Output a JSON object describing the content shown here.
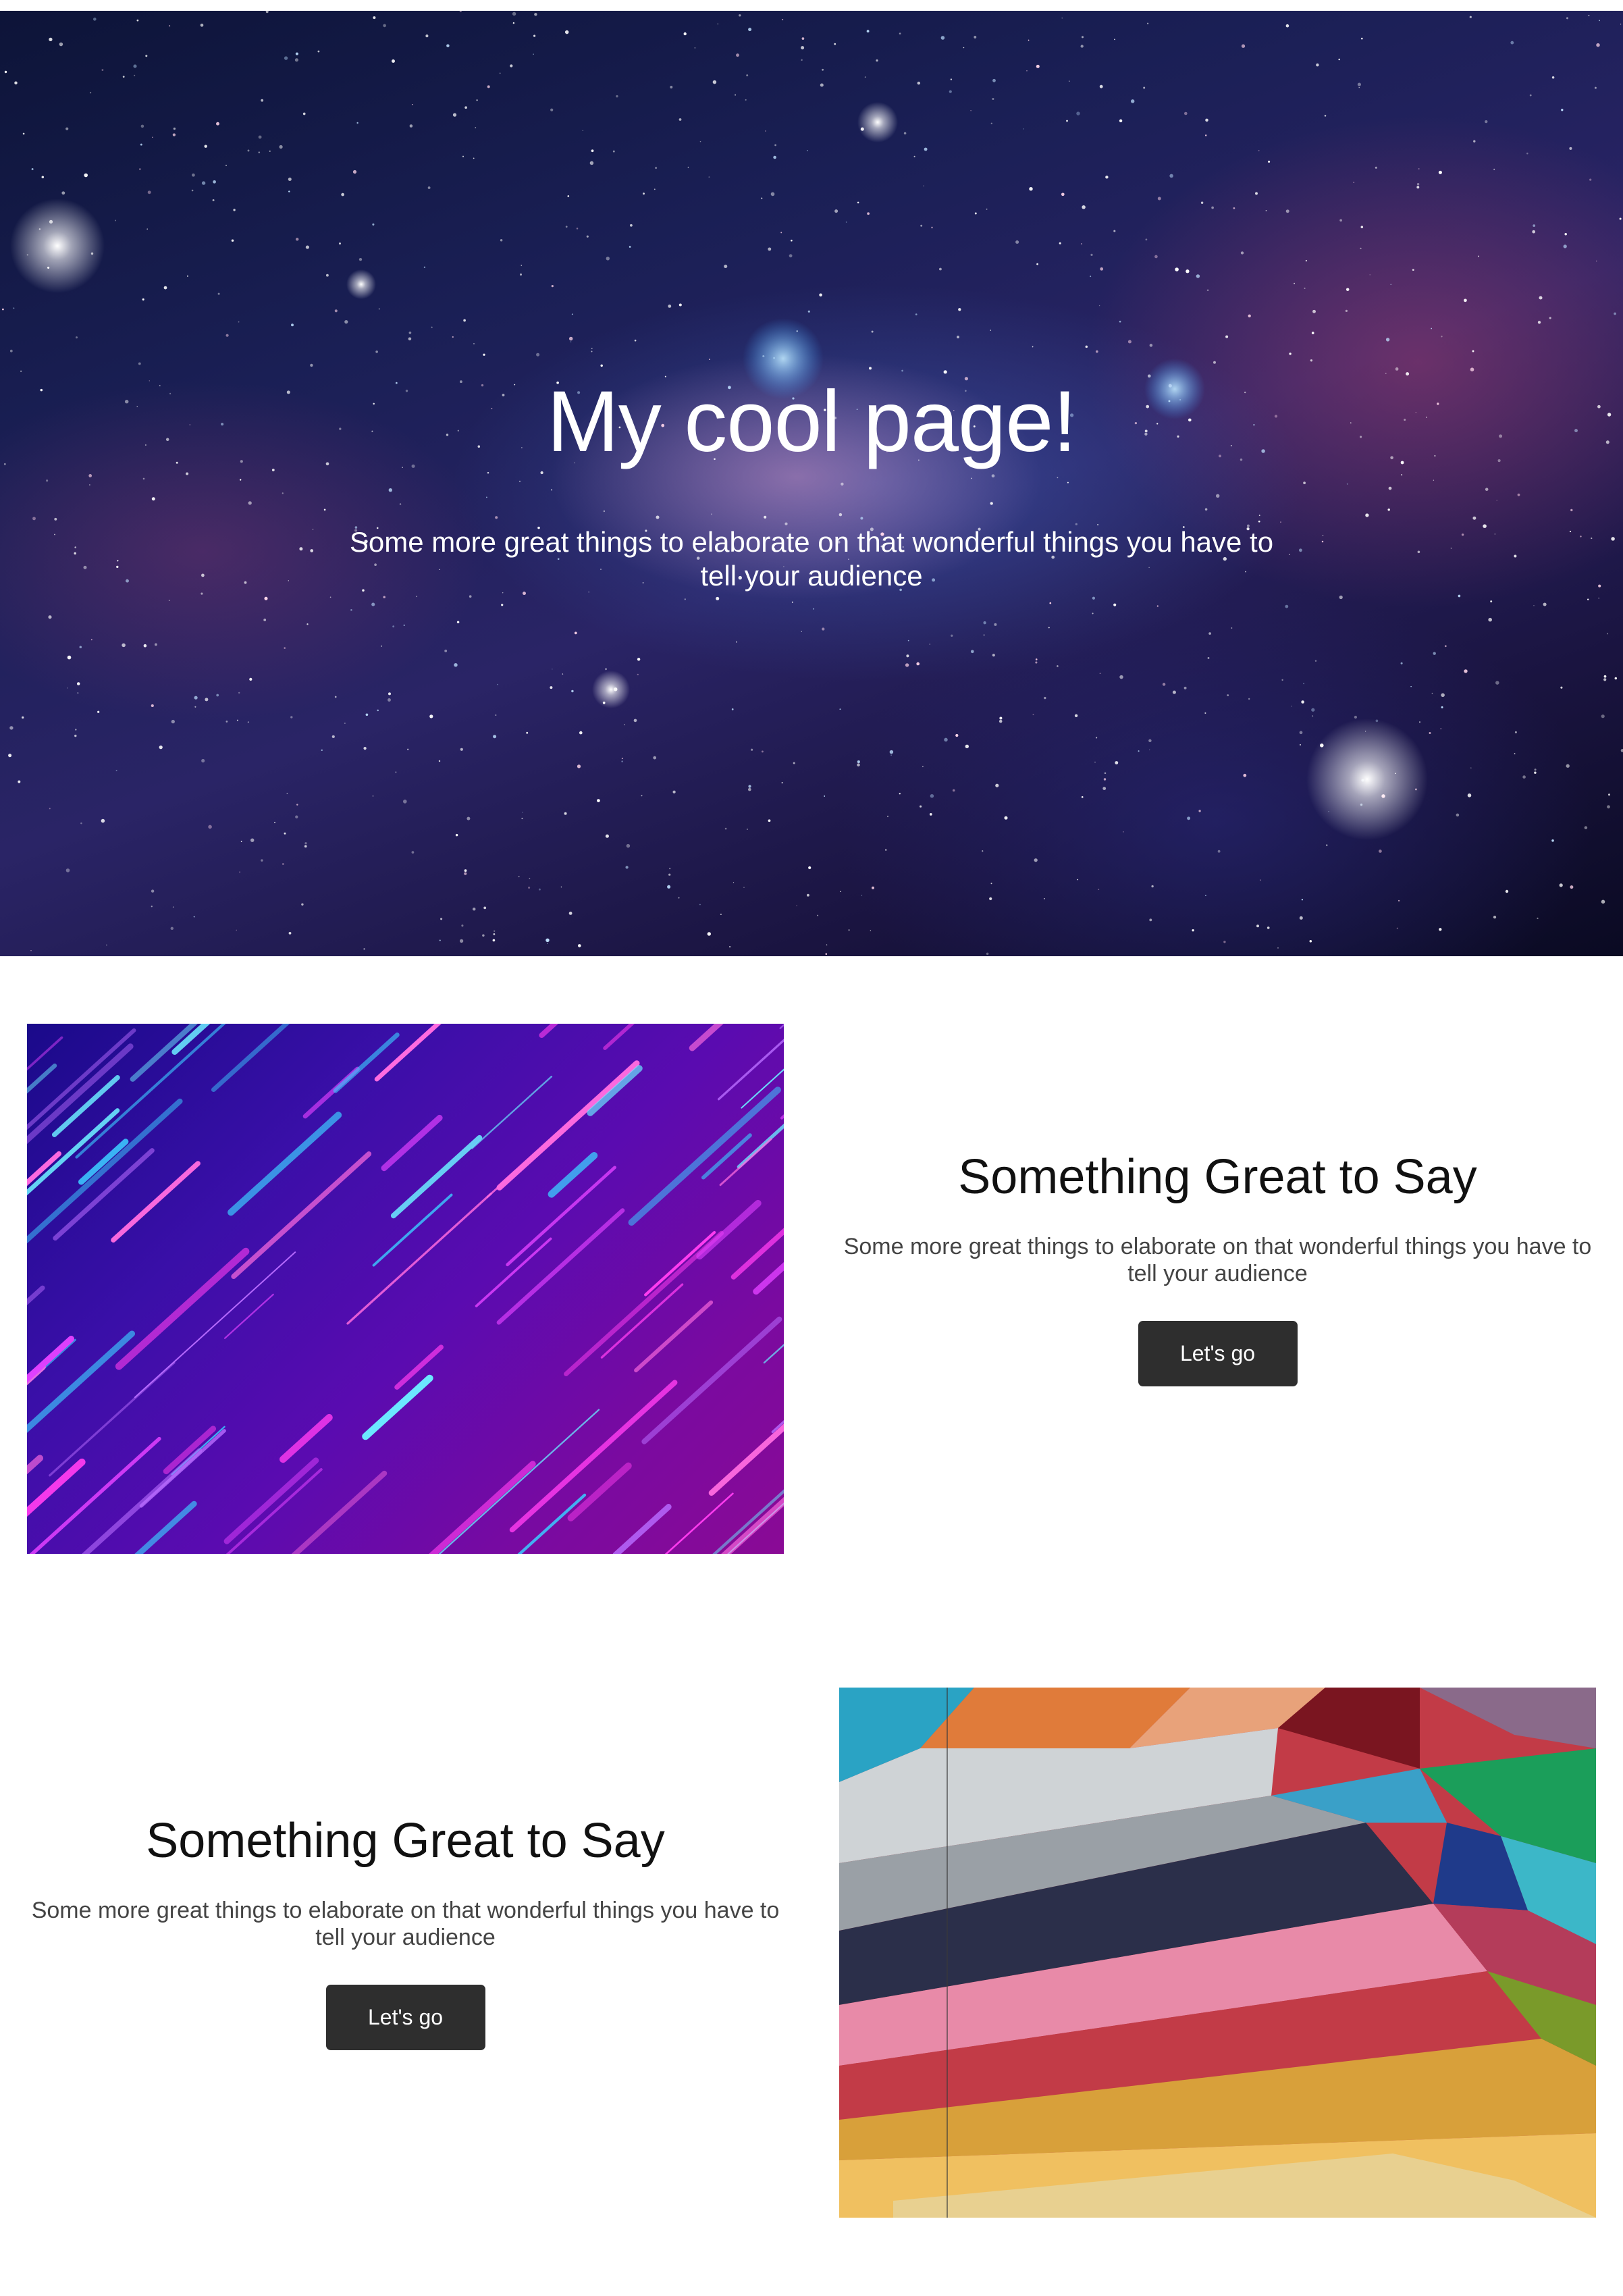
{
  "hero": {
    "title": "My cool page!",
    "subtitle": "Some more great things to elaborate on that wonderful things you have to tell your audience",
    "background": "starfield-galaxy"
  },
  "features": [
    {
      "image": "neon-light-streaks",
      "heading": "Something Great to Say",
      "body": "Some more great things to elaborate on that wonderful things you have to tell your audience",
      "button_label": "Let's go"
    },
    {
      "image": "geometric-colorful-mural",
      "heading": "Something Great to Say",
      "body": "Some more great things to elaborate on that wonderful things you have to tell your audience",
      "button_label": "Let's go"
    }
  ],
  "colors": {
    "button_bg": "#2e2e2e",
    "button_text": "#ffffff",
    "heading": "#111111",
    "body_text": "#444444",
    "page_bg": "#ffffff"
  }
}
